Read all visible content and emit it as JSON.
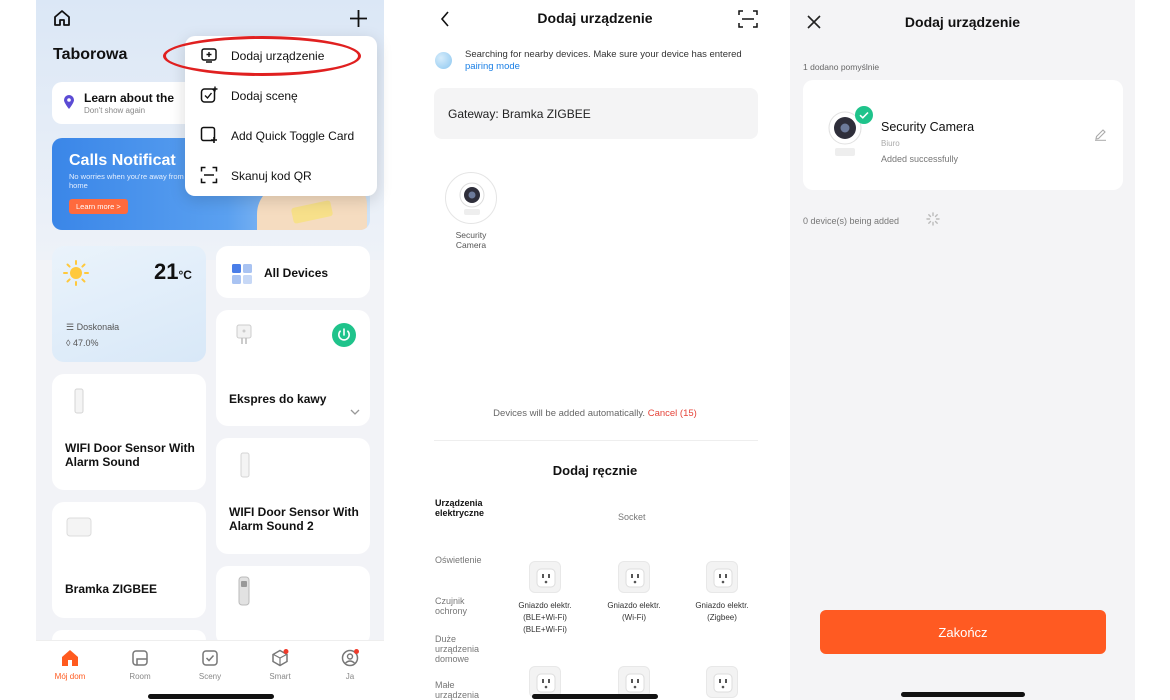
{
  "screen1": {
    "home_name": "Taborowa",
    "learn": {
      "title": "Learn about the",
      "subtitle": "Don't show again"
    },
    "banner": {
      "title": "Calls Notificat",
      "subtitle": "No worries when you're away from home",
      "button": "Learn more >"
    },
    "weather": {
      "temp": "21",
      "unit": "°C",
      "condition": "Doskonała",
      "humidity": "47.0%"
    },
    "all_devices": "All Devices",
    "tiles": {
      "ekspres": "Ekspres do kawy",
      "door1": "WIFI Door Sensor With Alarm Sound",
      "door2": "WIFI Door Sensor With Alarm Sound 2",
      "bramka": "Bramka ZIGBEE"
    },
    "menu": [
      {
        "label": "Dodaj urządzenie",
        "icon": "add-device-icon"
      },
      {
        "label": "Dodaj scenę",
        "icon": "add-scene-icon"
      },
      {
        "label": "Add Quick Toggle Card",
        "icon": "add-card-icon"
      },
      {
        "label": "Skanuj kod QR",
        "icon": "scan-qr-icon"
      }
    ],
    "tabs": [
      {
        "label": "Mój dom",
        "icon": "home-tab-icon",
        "active": true
      },
      {
        "label": "Room",
        "icon": "room-tab-icon"
      },
      {
        "label": "Sceny",
        "icon": "scenes-tab-icon"
      },
      {
        "label": "Smart",
        "icon": "smart-tab-icon"
      },
      {
        "label": "Ja",
        "icon": "profile-tab-icon"
      }
    ],
    "accent": "#ff5a1f",
    "highlight": "#e02020"
  },
  "screen2": {
    "title": "Dodaj urządzenie",
    "search_text": "Searching for nearby devices. Make sure your device has entered",
    "search_link": "pairing mode",
    "gateway": "Gateway: Bramka ZIGBEE",
    "found_device": "Security Camera",
    "auto_text": "Devices will be added automatically.",
    "cancel": "Cancel (15)",
    "manual_title": "Dodaj ręcznie",
    "categories": [
      "Urządzenia elektryczne",
      "Oświetlenie",
      "Czujnik ochrony",
      "Duże urządzenia domowe",
      "Małe urządzenia"
    ],
    "socket_heading": "Socket",
    "sockets": [
      {
        "name": "Gniazdo elektr.",
        "detail": "(BLE+Wi-Fi) (BLE+Wi-Fi)"
      },
      {
        "name": "Gniazdo elektr.",
        "detail": "(Wi-Fi)"
      },
      {
        "name": "Gniazdo elektr.",
        "detail": "(Zigbee)"
      }
    ],
    "link_color": "#1a7fe5",
    "cancel_color": "#e5443a"
  },
  "screen3": {
    "title": "Dodaj urządzenie",
    "added_count": "1 dodano pomyślnie",
    "device": {
      "name": "Security Camera",
      "room": "Biuro",
      "status": "Added successfully"
    },
    "being_added": "0 device(s) being added",
    "finish": "Zakończ",
    "button_color": "#ff5a22",
    "success_color": "#1fc38b"
  }
}
